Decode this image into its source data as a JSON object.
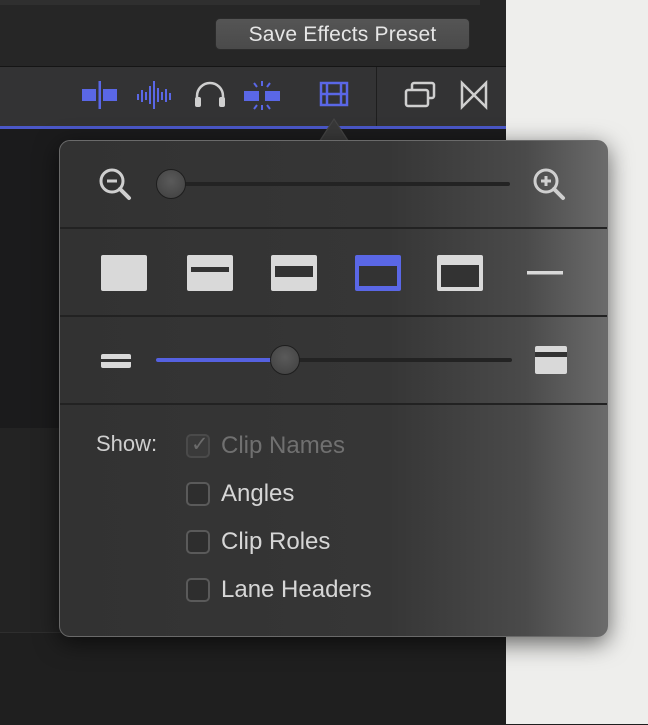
{
  "header": {
    "save_preset_button": "Save Effects Preset"
  },
  "toolbar": {
    "icons": [
      "clip-skimming-icon",
      "audio-skimming-icon",
      "headphones-solo-icon",
      "snapping-icon",
      "clip-appearance-icon",
      "timeline-index-icon",
      "transitions-browser-icon"
    ],
    "accent_color": "#5a67e6"
  },
  "popover": {
    "zoom": {
      "zoom_out_icon": "zoom-out-icon",
      "zoom_in_icon": "zoom-in-icon",
      "level": 0.0
    },
    "clip_appearance": {
      "modes": [
        "waveform-only",
        "large-waveform",
        "waveform-and-filmstrip",
        "large-filmstrip",
        "filmstrip-only",
        "clip-labels-only"
      ],
      "selected_index": 3
    },
    "clip_height": {
      "small_icon": "small-height-icon",
      "large_icon": "large-height-icon",
      "level": 0.35
    },
    "show": {
      "label": "Show:",
      "options": [
        {
          "label": "Clip Names",
          "checked": true,
          "enabled": false
        },
        {
          "label": "Angles",
          "checked": false,
          "enabled": true
        },
        {
          "label": "Clip Roles",
          "checked": false,
          "enabled": true
        },
        {
          "label": "Lane Headers",
          "checked": false,
          "enabled": true
        }
      ]
    }
  }
}
